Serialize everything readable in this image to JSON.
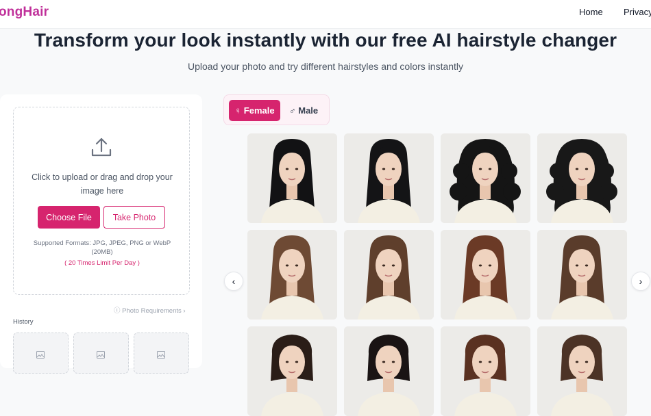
{
  "nav": {
    "logo": "ongHair",
    "home": "Home",
    "privacy": "Privacy"
  },
  "hero": {
    "title": "Transform your look instantly with our free AI hairstyle changer",
    "subtitle": "Upload your photo and try different hairstyles and colors instantly"
  },
  "upload": {
    "prompt": "Click to upload or drag and drop your image here",
    "choose_label": "Choose File",
    "photo_label": "Take Photo",
    "formats": "Supported Formats: JPG, JPEG, PNG or WebP (20MB)",
    "limit": "( 20 Times Limit Per Day )",
    "requirements": "Photo Requirements"
  },
  "history": {
    "label": "History"
  },
  "gender": {
    "female": "Female",
    "male": "Male",
    "female_icon": "female-symbol-icon",
    "male_icon": "male-symbol-icon"
  },
  "colors": {
    "accent": "#d6246e",
    "logo": "#c0309a"
  },
  "styles": [
    {
      "name": "long-straight-black",
      "hair_color": "#121214"
    },
    {
      "name": "long-bangs-black",
      "hair_color": "#141416"
    },
    {
      "name": "curly-black",
      "hair_color": "#151515"
    },
    {
      "name": "long-curly-black",
      "hair_color": "#181818"
    },
    {
      "name": "wavy-brown",
      "hair_color": "#6e4a34"
    },
    {
      "name": "wavy-brown-2",
      "hair_color": "#5f3f2c"
    },
    {
      "name": "long-auburn",
      "hair_color": "#6b3a26"
    },
    {
      "name": "layered-brown",
      "hair_color": "#5a3c2b"
    },
    {
      "name": "short-dark",
      "hair_color": "#2a1d17"
    },
    {
      "name": "short-black",
      "hair_color": "#1a1414"
    },
    {
      "name": "short-auburn",
      "hair_color": "#5a3121"
    },
    {
      "name": "short-brown",
      "hair_color": "#4c3326"
    }
  ]
}
